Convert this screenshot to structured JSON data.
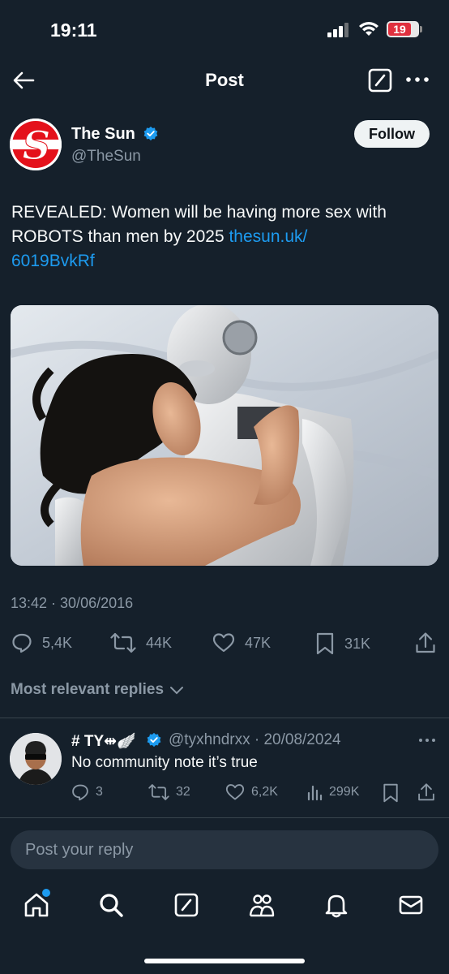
{
  "status_bar": {
    "time": "19:11",
    "battery": "19"
  },
  "header": {
    "title": "Post"
  },
  "post": {
    "author_name": "The Sun",
    "author_handle": "@TheSun",
    "follow_label": "Follow",
    "text_main": "REVEALED: Women will be having more sex with ROBOTS than men by 2025 ",
    "text_link_1": "thesun.uk/",
    "text_link_2": "6019BvkRf",
    "datetime": "13:42 · 30/06/2016",
    "stats": {
      "replies": "5,4K",
      "reposts": "44K",
      "likes": "47K",
      "bookmarks": "31K"
    }
  },
  "replies_filter": "Most relevant replies",
  "reply": {
    "name": "# TY⇹🪽",
    "handle_date": "@tyxhndrxx · 20/08/2024",
    "text": "No community note it’s true",
    "stats": {
      "replies": "3",
      "reposts": "32",
      "likes": "6,2K",
      "views": "299K"
    }
  },
  "reply_input": {
    "placeholder": "Post your reply"
  },
  "colors": {
    "background": "#15202b",
    "accent": "#1d9bf0",
    "muted": "#8b98a5",
    "divider": "#38444d"
  },
  "icons": [
    "back-arrow-icon",
    "grok-icon",
    "more-icon",
    "verified-icon",
    "reply-icon",
    "repost-icon",
    "like-icon",
    "bookmark-icon",
    "share-icon",
    "views-icon",
    "home-icon",
    "search-icon",
    "communities-icon",
    "notifications-icon",
    "messages-icon"
  ]
}
